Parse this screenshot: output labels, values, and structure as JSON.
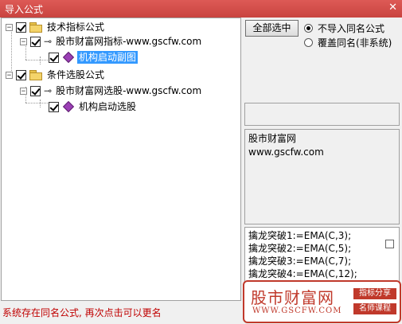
{
  "window": {
    "title": "导入公式",
    "close_glyph": "✕"
  },
  "tree": {
    "expand_glyph": "−",
    "nodes": [
      {
        "label": "技术指标公式",
        "icon": "folder-icon",
        "checked": true
      },
      {
        "label": "股市财富网指标-www.gscfw.com",
        "icon": "key-icon",
        "checked": true
      },
      {
        "label": "机构启动副图",
        "icon": "gem-icon",
        "checked": true,
        "selected": true
      },
      {
        "label": "条件选股公式",
        "icon": "folder-icon",
        "checked": true
      },
      {
        "label": "股市财富网选股-www.gscfw.com",
        "icon": "key-icon",
        "checked": true
      },
      {
        "label": "机构启动选股",
        "icon": "gem-icon",
        "checked": true
      }
    ]
  },
  "controls": {
    "select_all_label": "全部选中",
    "radio_skip_label": "不导入同名公式",
    "radio_overwrite_label": "覆盖同名(非系统)",
    "selected_option": "不导入同名公式"
  },
  "description": {
    "line1": "股市财富网",
    "line2": "www.gscfw.com"
  },
  "code": {
    "lines": [
      "擒龙突破1:=EMA(C,3);",
      "擒龙突破2:=EMA(C,5);",
      "擒龙突破3:=EMA(C,7);",
      "擒龙突破4:=EMA(C,12);"
    ]
  },
  "status": {
    "message": "系统存在同名公式, 再次点击可以更名"
  },
  "watermark": {
    "title": "股市财富网",
    "url": "WWW.GSCFW.COM",
    "tag1": "指标分享",
    "tag2": "名师课程"
  },
  "colors": {
    "titlebar": "#d9534f",
    "selection": "#3399ff",
    "status_text": "#c00000",
    "watermark": "#c0392b"
  }
}
